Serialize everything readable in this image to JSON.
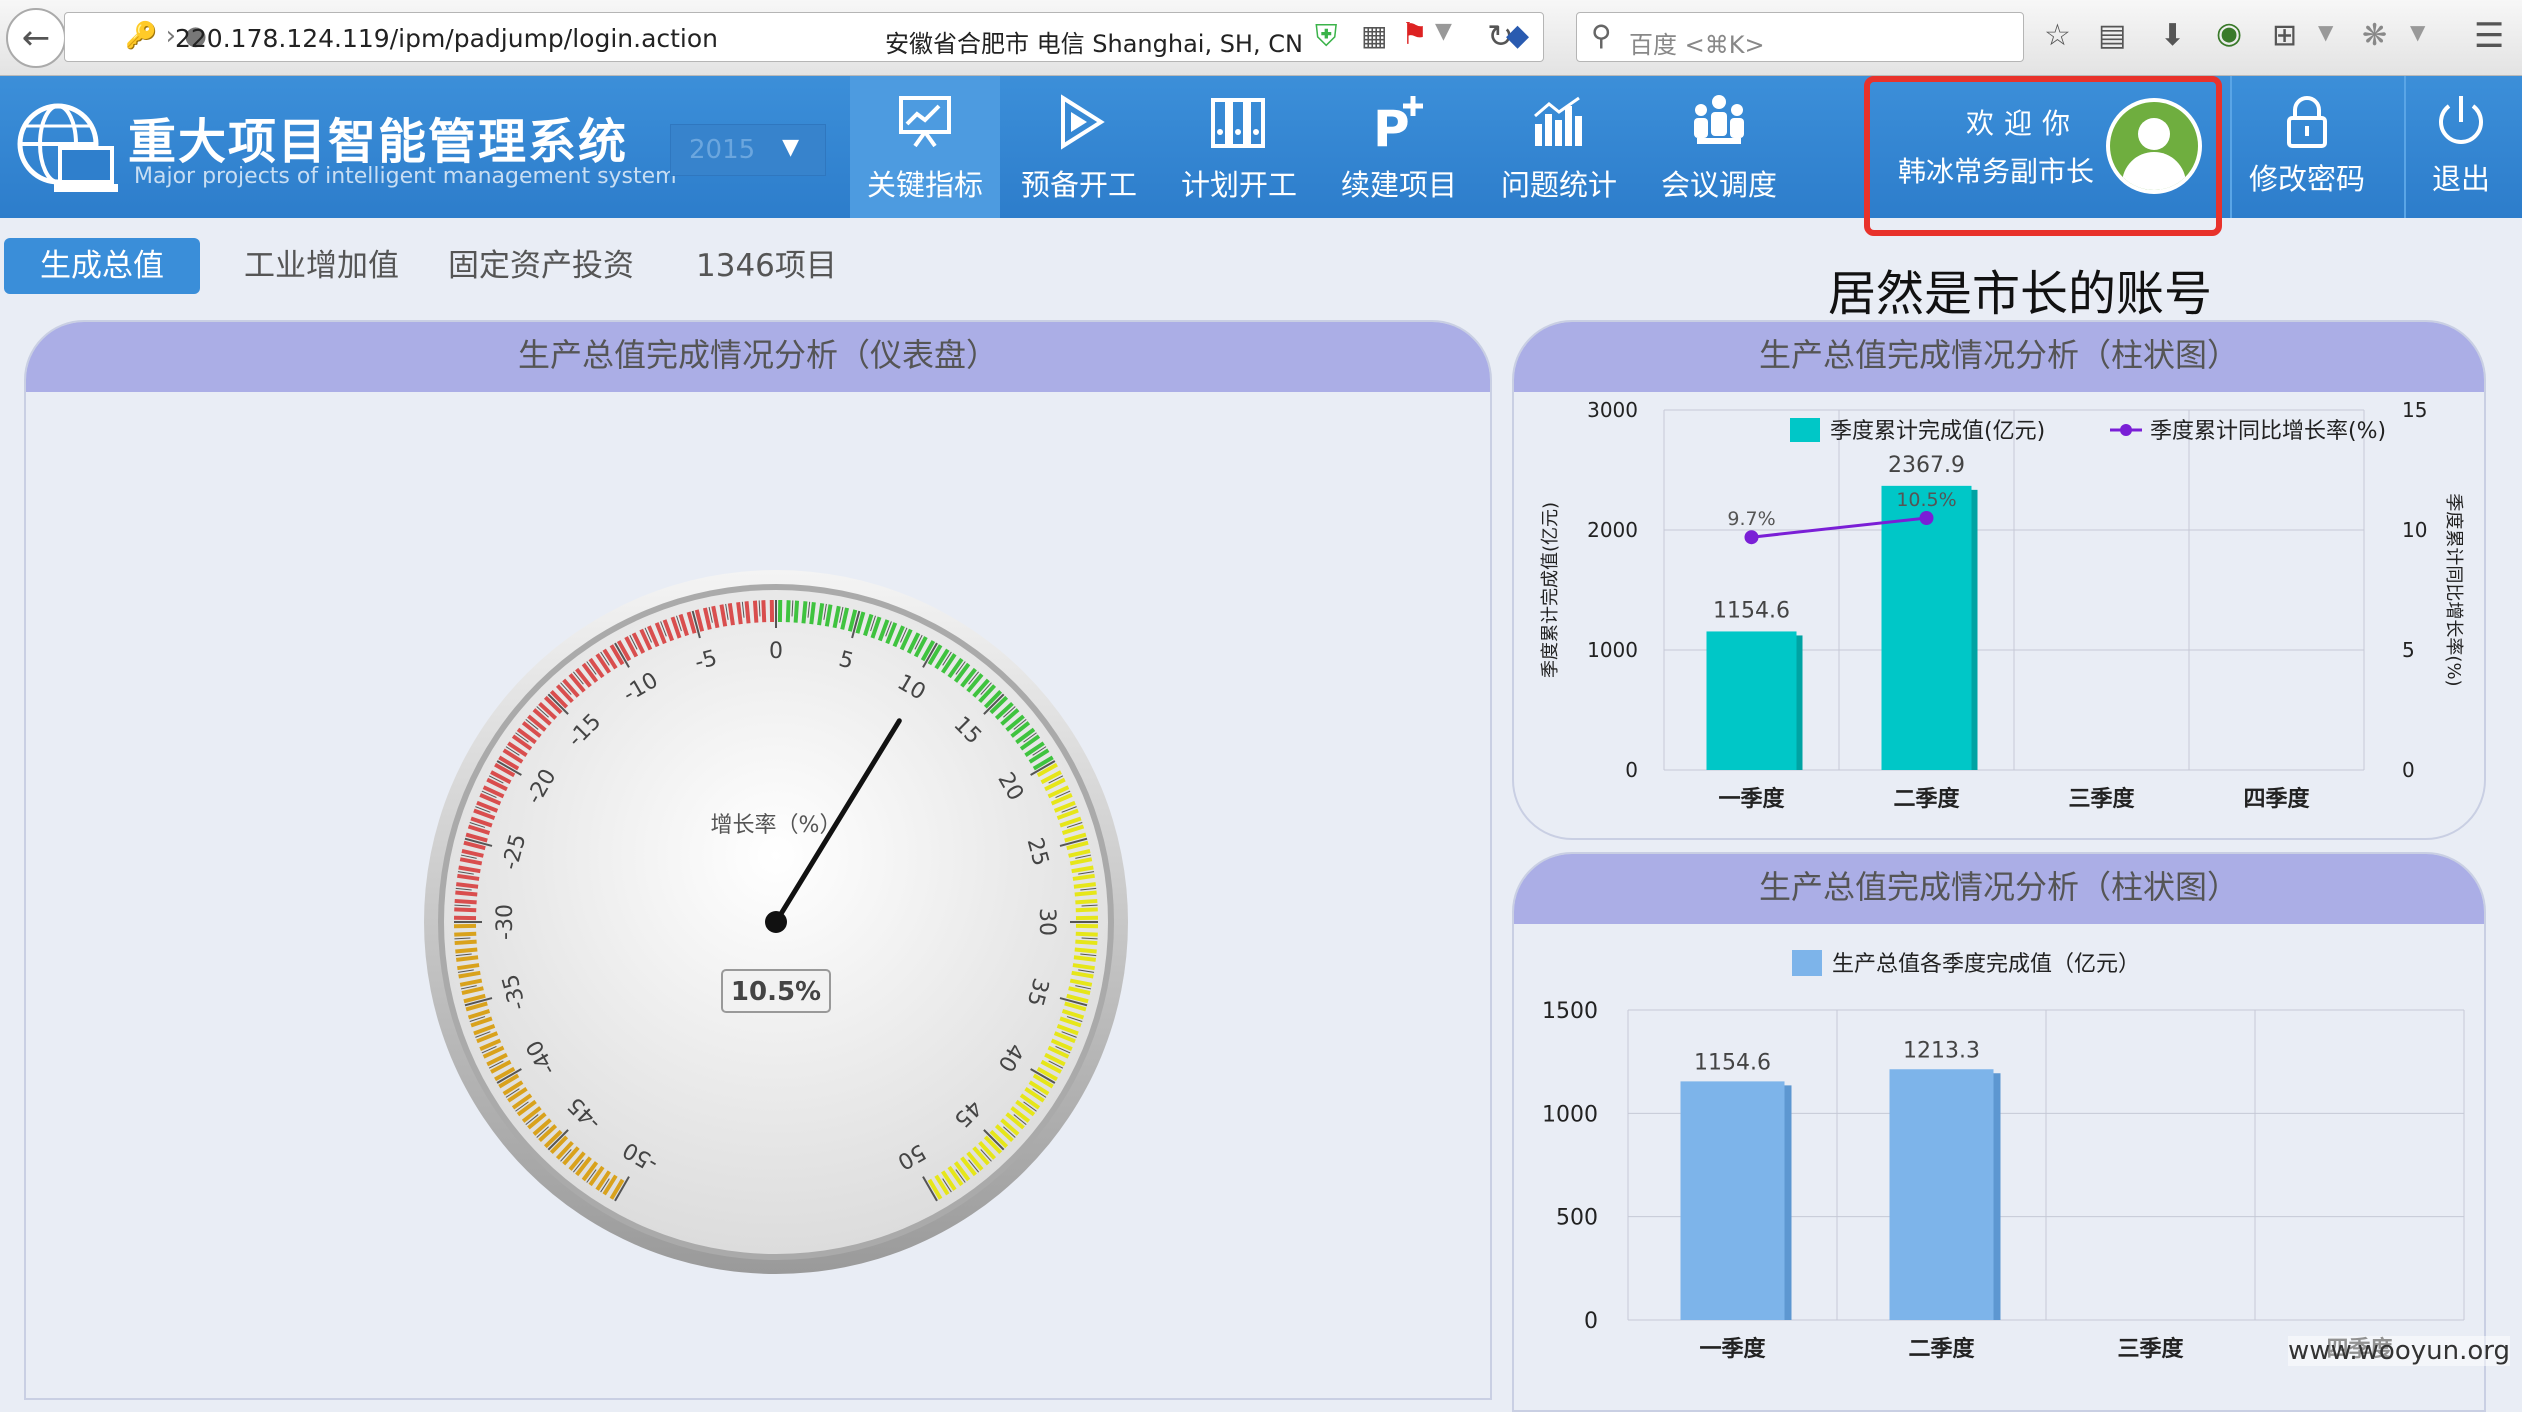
{
  "browser": {
    "url": "220.178.124.119/ipm/padjump/login.action",
    "location": "安徽省合肥市 电信   Shanghai, SH, CN",
    "search_placeholder": "百度 <⌘K>",
    "back_icon": "back-arrow-icon"
  },
  "header": {
    "title": "重大项目智能管理系统",
    "subtitle": "Major projects of intelligent management system",
    "year": "2015",
    "nav": [
      {
        "label": "关键指标",
        "icon": "presentation-chart-icon",
        "active": true
      },
      {
        "label": "预备开工",
        "icon": "play-icon",
        "active": false
      },
      {
        "label": "计划开工",
        "icon": "binders-icon",
        "active": false
      },
      {
        "label": "续建项目",
        "icon": "p-plus-icon",
        "active": false
      },
      {
        "label": "问题统计",
        "icon": "bar-stats-icon",
        "active": false
      },
      {
        "label": "会议调度",
        "icon": "meeting-icon",
        "active": false
      }
    ],
    "welcome": "欢迎你",
    "user": "韩冰常务副市长",
    "change_password": "修改密码",
    "logout": "退出"
  },
  "tabs": [
    {
      "label": "生成总值",
      "active": true
    },
    {
      "label": "工业增加值",
      "active": false
    },
    {
      "label": "固定资产投资",
      "active": false
    },
    {
      "label": "1346项目",
      "active": false
    }
  ],
  "annotation": "居然是市长的账号",
  "gauge": {
    "title": "生产总值完成情况分析（仪表盘）",
    "label": "增长率（%）",
    "value": 10.5,
    "value_text": "10.5%",
    "min": -50,
    "max": 50,
    "band_colors": {
      "red": "#d94e4e",
      "orange": "#d9a21c",
      "green": "#3fc33f",
      "yellow": "#e6e619"
    }
  },
  "chart_data": [
    {
      "type": "bar",
      "title": "生产总值完成情况分析（柱状图）",
      "categories": [
        "一季度",
        "二季度",
        "三季度",
        "四季度"
      ],
      "series": [
        {
          "name": "季度累计完成值(亿元)",
          "values": [
            1154.6,
            2367.9,
            null,
            null
          ],
          "color": "#00c7c7"
        },
        {
          "name": "季度累计同比增长率(%)",
          "type": "line",
          "values": [
            9.7,
            10.5,
            null,
            null
          ],
          "labels": [
            "9.7%",
            "10.5%"
          ],
          "color": "#7a1fd6"
        }
      ],
      "ylabel": "季度累计完成值(亿元)",
      "y2label": "季度累计同比增长率(%)",
      "ylim": [
        0,
        3000
      ],
      "yticks": [
        0,
        1000,
        2000,
        3000
      ],
      "y2lim": [
        0,
        15
      ],
      "y2ticks": [
        0,
        5,
        10,
        15
      ],
      "grid": true,
      "legend": "top"
    },
    {
      "type": "bar",
      "title": "生产总值完成情况分析（柱状图）",
      "categories": [
        "一季度",
        "二季度",
        "三季度",
        "四季度"
      ],
      "series": [
        {
          "name": "生产总值各季度完成值（亿元）",
          "values": [
            1154.6,
            1213.3,
            null,
            null
          ],
          "color": "#7db4ea"
        }
      ],
      "ylim": [
        0,
        1500
      ],
      "yticks": [
        0,
        500,
        1000,
        1500
      ],
      "grid": true,
      "legend": "top"
    }
  ],
  "watermark": "www.wooyun.org"
}
